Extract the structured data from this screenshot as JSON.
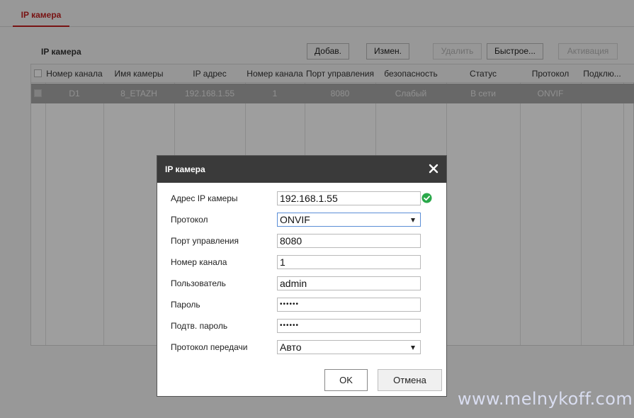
{
  "tab": {
    "label": "IP камера"
  },
  "panel": {
    "title": "IP камера"
  },
  "toolbar": {
    "add": "Добав.",
    "edit": "Измен.",
    "delete": "Удалить",
    "quick": "Быстрое...",
    "activate": "Активация"
  },
  "table": {
    "headers": [
      "Номер канала",
      "Имя камеры",
      "IP адрес",
      "Номер канала",
      "Порт управления",
      "безопасность",
      "Статус",
      "Протокол",
      "Подклю..."
    ],
    "rows": [
      [
        "D1",
        "8_ETAZH",
        "192.168.1.55",
        "1",
        "8080",
        "Слабый",
        "В сети",
        "ONVIF",
        ""
      ]
    ]
  },
  "dialog": {
    "title": "IP камера",
    "fields": {
      "ip_address": {
        "label": "Адрес IP камеры",
        "value": "192.168.1.55"
      },
      "protocol": {
        "label": "Протокол",
        "value": "ONVIF"
      },
      "mgmt_port": {
        "label": "Порт управления",
        "value": "8080"
      },
      "channel": {
        "label": "Номер канала",
        "value": "1"
      },
      "user": {
        "label": "Пользователь",
        "value": "admin"
      },
      "password": {
        "label": "Пароль",
        "value": "••••••"
      },
      "confirm_password": {
        "label": "Подтв. пароль",
        "value": "••••••"
      },
      "transport": {
        "label": "Протокол передачи",
        "value": "Авто"
      }
    },
    "ok": "OK",
    "cancel": "Отмена"
  },
  "watermark": "www.melnykoff.com",
  "colors": {
    "accent": "#c21f1f",
    "dialog_header": "#3a3a3a",
    "valid": "#2aa84a"
  }
}
